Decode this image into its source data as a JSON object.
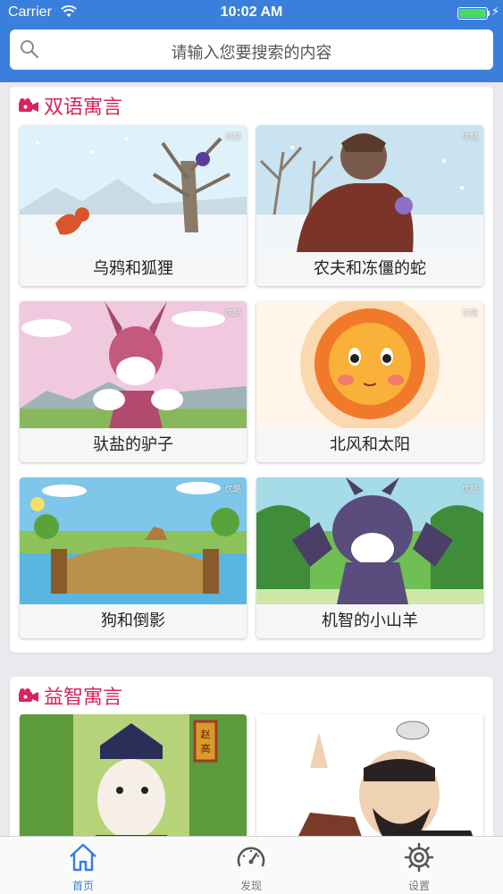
{
  "status_bar": {
    "carrier": "Carrier",
    "time": "10:02 AM",
    "battery_level": 1.0
  },
  "search": {
    "placeholder": "请输入您要搜索的内容"
  },
  "sections": [
    {
      "title": "双语寓言",
      "icon": "video-camera-icon",
      "cards": [
        {
          "title": "乌鸦和狐狸",
          "watermark": "优酷"
        },
        {
          "title": "农夫和冻僵的蛇",
          "watermark": "优酷"
        },
        {
          "title": "驮盐的驴子",
          "watermark": "优酷"
        },
        {
          "title": "北风和太阳",
          "watermark": "优酷"
        },
        {
          "title": "狗和倒影",
          "watermark": "优酷"
        },
        {
          "title": "机智的小山羊",
          "watermark": "优酷"
        }
      ]
    },
    {
      "title": "益智寓言",
      "icon": "video-camera-icon",
      "cards": [
        {
          "sign_text": "赵高"
        },
        {}
      ]
    }
  ],
  "tabbar": {
    "items": [
      {
        "label": "首页",
        "icon": "home-icon",
        "active": true
      },
      {
        "label": "发现",
        "icon": "speedometer-icon",
        "active": false
      },
      {
        "label": "设置",
        "icon": "gear-icon",
        "active": false
      }
    ]
  },
  "colors": {
    "header_blue": "#3a7fdb",
    "section_title": "#d5255c",
    "battery_green": "#4cd964",
    "tab_active": "#3a7fdb"
  }
}
